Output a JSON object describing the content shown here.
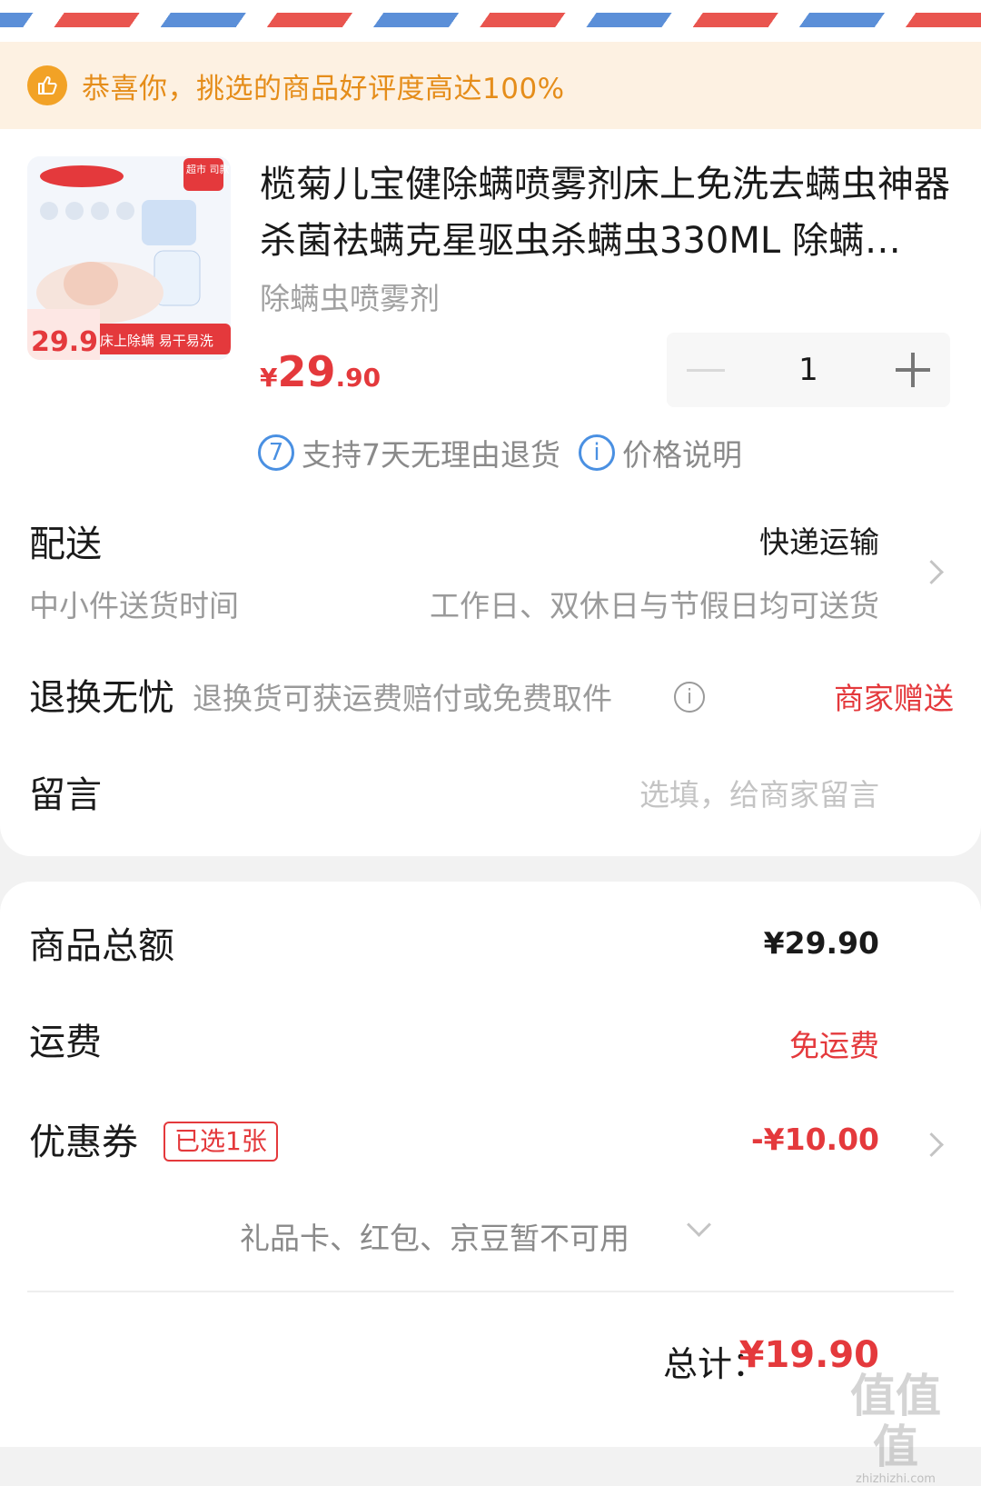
{
  "notice": {
    "text": "恭喜你，挑选的商品好评度高达100%",
    "icon": "thumbs-up-icon"
  },
  "product": {
    "title": "榄菊儿宝健除螨喷雾剂床上免洗去螨虫神器杀菌祛螨克星驱虫杀螨虫330ML 除螨…",
    "spec": "除螨虫喷雾剂",
    "price_currency": "¥",
    "price_int": "29",
    "price_dec": ".90",
    "quantity": "1",
    "image_badge_price": "29.9",
    "image_banner": "床上除螨 易干易洗",
    "image_tag": "超市 司款"
  },
  "policy": {
    "returns_icon_label": "7",
    "returns_text": "支持7天无理由退货",
    "price_icon_label": "i",
    "price_text": "价格说明"
  },
  "delivery": {
    "label": "配送",
    "method": "快递运输",
    "time_label": "中小件送货时间",
    "time_value": "工作日、双休日与节假日均可送货"
  },
  "return_worry_free": {
    "label": "退换无忧",
    "desc": "退换货可获运费赔付或免费取件",
    "value": "商家赠送"
  },
  "message": {
    "label": "留言",
    "placeholder": "选填，给商家留言"
  },
  "summary": {
    "goods_total_label": "商品总额",
    "goods_total_value": "¥29.90",
    "shipping_label": "运费",
    "shipping_value": "免运费",
    "coupon_label": "优惠券",
    "coupon_badge": "已选1张",
    "coupon_value": "-¥10.00",
    "unavailable_text": "礼品卡、红包、京豆暂不可用",
    "total_label": "总计：",
    "total_value": "¥19.90"
  },
  "watermark": {
    "text": "值值值",
    "url_text": "zhizhizhi.com"
  },
  "colors": {
    "accent_red": "#e4393c",
    "notice_orange": "#e58d1a",
    "link_blue": "#4a90e2"
  }
}
